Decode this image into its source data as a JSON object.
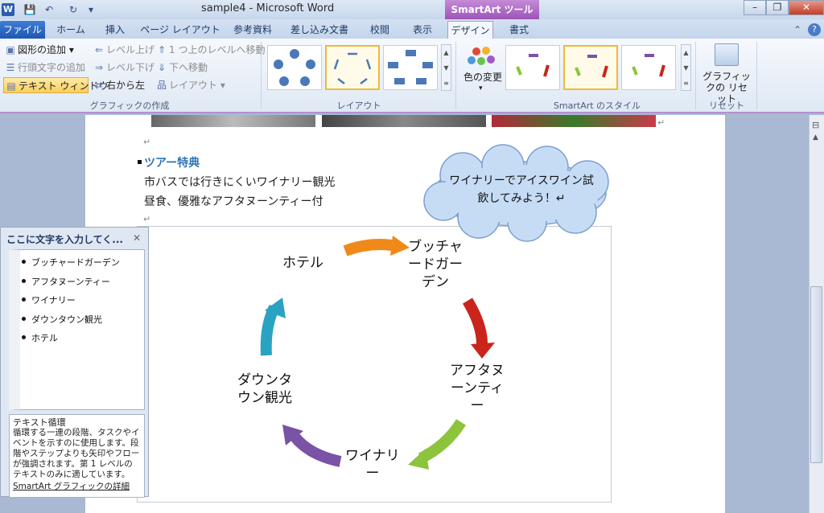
{
  "window": {
    "title": "sample4 - Microsoft Word",
    "context_tools": "SmartArt ツール"
  },
  "qat": {
    "word_icon": "W",
    "save": "💾",
    "undo": "↶",
    "redo": "↻",
    "customize": "▾"
  },
  "tabs": [
    "ファイル",
    "ホーム",
    "挿入",
    "ページ レイアウト",
    "参考資料",
    "差し込み文書",
    "校閲",
    "表示",
    "デザイン",
    "書式"
  ],
  "ribbon": {
    "create": {
      "add_shape": "図形の追加",
      "add_bullet": "行頭文字の追加",
      "text_pane": "テキスト ウィンドウ",
      "promote": "レベル上げ",
      "demote": "レベル下げ",
      "right_to_left": "右から左",
      "move_up": "1 つ上のレベルへ移動",
      "move_down": "下へ移動",
      "layout": "レイアウト",
      "group": "グラフィックの作成"
    },
    "layouts_group": "レイアウト",
    "change_colors": "色の変更",
    "styles_group": "SmartArt のスタイル",
    "reset_graphic": "グラフィックの リセット",
    "reset_group": "リセット"
  },
  "doc": {
    "heading": "ツアー特典",
    "line1": "市バスでは行きにくいワイナリー観光",
    "line2": "昼食、優雅なアフタヌーンティー付",
    "para_mark": "↵",
    "cloud": "ワイナリーでアイスワイン試飲してみよう！↵"
  },
  "smartart": {
    "nodes": [
      "ホテル",
      "ブッチャードガーデン",
      "アフタヌーンティー",
      "ワイナリー",
      "ダウンタウン観光"
    ],
    "node_lines": {
      "butchart": [
        "ブッチャ",
        "ードガー",
        "デン"
      ],
      "afternoon": [
        "アフタヌ",
        "ーンティ",
        "ー"
      ],
      "winery": [
        "ワイナリ",
        "ー"
      ],
      "downtown": [
        "ダウンタ",
        "ウン観光"
      ]
    },
    "arrow_colors": {
      "orange": "#ef8a1a",
      "red": "#c9251c",
      "green": "#8cc43c",
      "purple": "#7a52a6",
      "teal": "#2aa3c2"
    }
  },
  "text_pane": {
    "title": "ここに文字を入力してく...",
    "items": [
      "ブッチャードガーデン",
      "アフタヌーンティー",
      "ワイナリー",
      "ダウンタウン観光",
      "ホテル"
    ],
    "desc_title": "テキスト循環",
    "desc": "循環する一連の段階、タスクやイベントを示すのに使用します。段階やステップよりも矢印やフローが強調されます。第 1 レベルのテキストのみに適しています。",
    "link": "SmartArt グラフィックの詳細"
  }
}
